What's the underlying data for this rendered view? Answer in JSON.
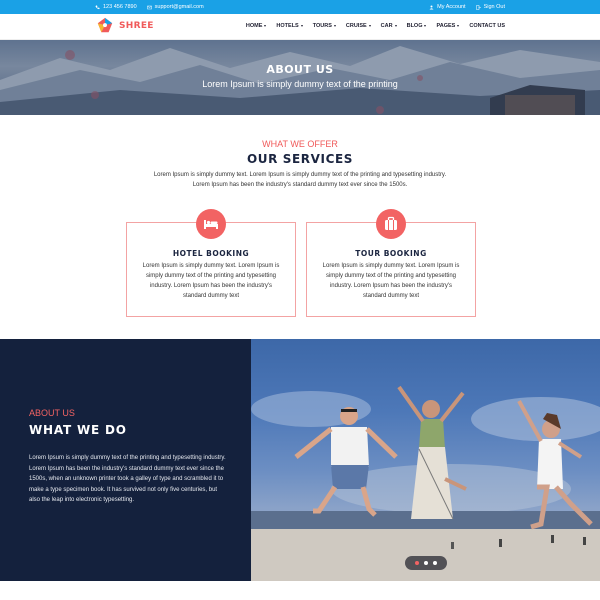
{
  "topbar": {
    "phone": "123 456 7890",
    "email": "support@gmail.com",
    "my_account": "My Account",
    "sign_out": "Sign Out"
  },
  "brand": {
    "name": "SHREE",
    "accent_color": "#f05a5a",
    "topbar_color": "#1aa1e6",
    "dark_color": "#14213d"
  },
  "nav": {
    "home": "HOME",
    "hotels": "HOTELS",
    "tours": "TOURS",
    "cruise": "CRUISE",
    "car": "CAR",
    "blog": "BLOG",
    "pages": "PAGES",
    "contact": "CONTACT US"
  },
  "hero": {
    "title": "ABOUT US",
    "subtitle": "Lorem Ipsum is simply dummy text of the printing"
  },
  "services": {
    "kicker": "WHAT WE OFFER",
    "title": "OUR SERVICES",
    "desc_line1": "Lorem Ipsum is simply dummy text. Lorem Ipsum is simply dummy text of the printing and typesetting industry.",
    "desc_line2": "Lorem Ipsum has been the industry's standard dummy text ever since the 1500s.",
    "cards": [
      {
        "icon": "bed-icon",
        "title": "HOTEL BOOKING",
        "desc": "Lorem Ipsum is simply dummy text. Lorem Ipsum is simply dummy text of the printing and typesetting industry. Lorem Ipsum has been the industry's standard dummy text"
      },
      {
        "icon": "suitcase-icon",
        "title": "TOUR BOOKING",
        "desc": "Lorem Ipsum is simply dummy text. Lorem Ipsum is simply dummy text of the printing and typesetting industry. Lorem Ipsum has been the industry's standard dummy text"
      }
    ]
  },
  "about": {
    "kicker": "ABOUT US",
    "title": "WHAT WE DO",
    "desc": "Lorem Ipsum is simply dummy text of the printing and typesetting industry. Lorem Ipsum has been the industry's standard dummy text ever since the 1500s, when an unknown printer took a galley of type and scrambled it to make a type specimen book. It has survived not only five centuries, but also the leap into electronic typesetting.",
    "slider_active": 1,
    "slider_count": 3
  }
}
